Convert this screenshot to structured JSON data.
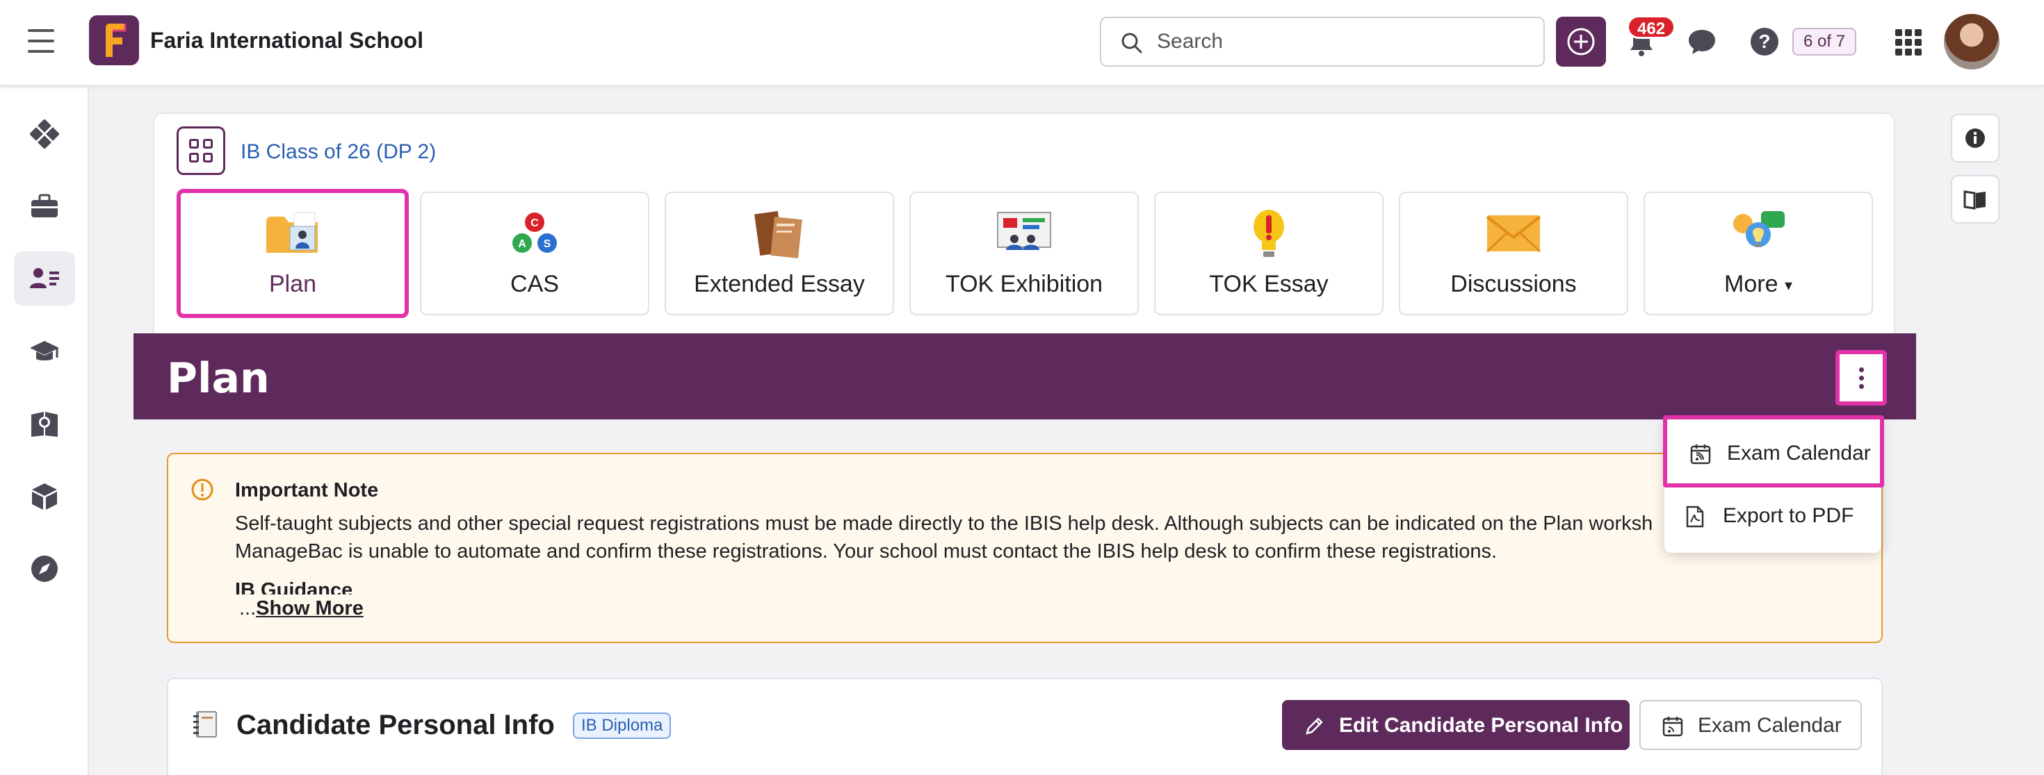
{
  "header": {
    "school_name": "Faria International School",
    "search_placeholder": "Search",
    "notifications_count": "462",
    "counter": "6 of 7"
  },
  "class": {
    "name": "IB Class of 26 (DP 2)"
  },
  "tiles": [
    {
      "label": "Plan",
      "icon": "folder-person-icon"
    },
    {
      "label": "CAS",
      "icon": "cas-triangle-icon"
    },
    {
      "label": "Extended Essay",
      "icon": "books-icon"
    },
    {
      "label": "TOK Exhibition",
      "icon": "presentation-board-icon"
    },
    {
      "label": "TOK Essay",
      "icon": "exclamation-bulb-icon"
    },
    {
      "label": "Discussions",
      "icon": "envelope-icon"
    },
    {
      "label": "More",
      "icon": "lightbulb-chat-icon"
    }
  ],
  "plan": {
    "title": "Plan"
  },
  "menu": {
    "items": [
      {
        "label": "Exam Calendar",
        "icon": "calendar-feed-icon"
      },
      {
        "label": "Export to PDF",
        "icon": "pdf-icon"
      }
    ]
  },
  "note": {
    "title": "Important Note",
    "line1": "Self-taught subjects and other special request registrations must be made directly to the IBIS help desk. Although subjects can be indicated on the Plan worksh",
    "line2": "ManageBac is unable to automate and confirm these registrations. Your school must contact the IBIS help desk to confirm these registrations.",
    "guidance": "IB Guidance",
    "ellipsis": "...",
    "show_more": "Show More"
  },
  "candidate": {
    "title": "Candidate Personal Info",
    "program": "IB Diploma",
    "edit_label": "Edit Candidate Personal Info",
    "calendar_label": "Exam Calendar"
  },
  "colors": {
    "brand": "#5e2a5c",
    "highlight": "#e132a8",
    "note_border": "#e29a2b",
    "link": "#2a5fb3"
  }
}
